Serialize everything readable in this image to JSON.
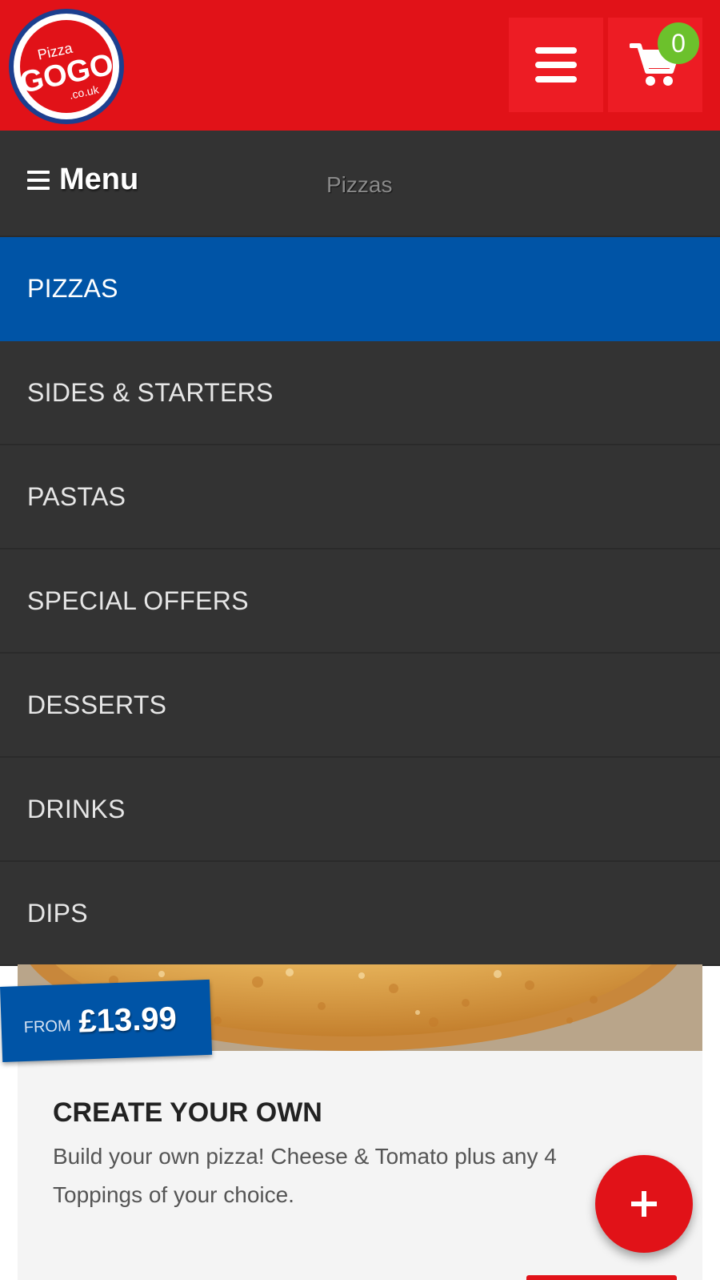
{
  "header": {
    "logo": {
      "small_text": "Pizza",
      "brand_text": "GOGO",
      "domain_text": ".co.uk"
    },
    "cart_count": "0",
    "colors": {
      "brand_red": "#e11218",
      "button_red": "#ed1c24",
      "badge_green": "#6cc12c"
    }
  },
  "menubar": {
    "title": "Menu",
    "breadcrumb": "Pizzas"
  },
  "categories": [
    {
      "label": "PIZZAS",
      "active": true
    },
    {
      "label": "SIDES & STARTERS",
      "active": false
    },
    {
      "label": "PASTAS",
      "active": false
    },
    {
      "label": "SPECIAL OFFERS",
      "active": false
    },
    {
      "label": "DESSERTS",
      "active": false
    },
    {
      "label": "DRINKS",
      "active": false
    },
    {
      "label": "DIPS",
      "active": false
    }
  ],
  "product": {
    "price_prefix": "FROM",
    "price": "£13.99",
    "title": "CREATE YOUR OWN",
    "description": "Build your own pizza! Cheese & Tomato plus any 4 Toppings of your choice."
  },
  "icons": {
    "menu": "hamburger-menu-icon",
    "cart": "shopping-cart-icon",
    "add": "plus-icon"
  },
  "colors": {
    "active_blue": "#0054a6",
    "dark_bg": "#333333"
  }
}
